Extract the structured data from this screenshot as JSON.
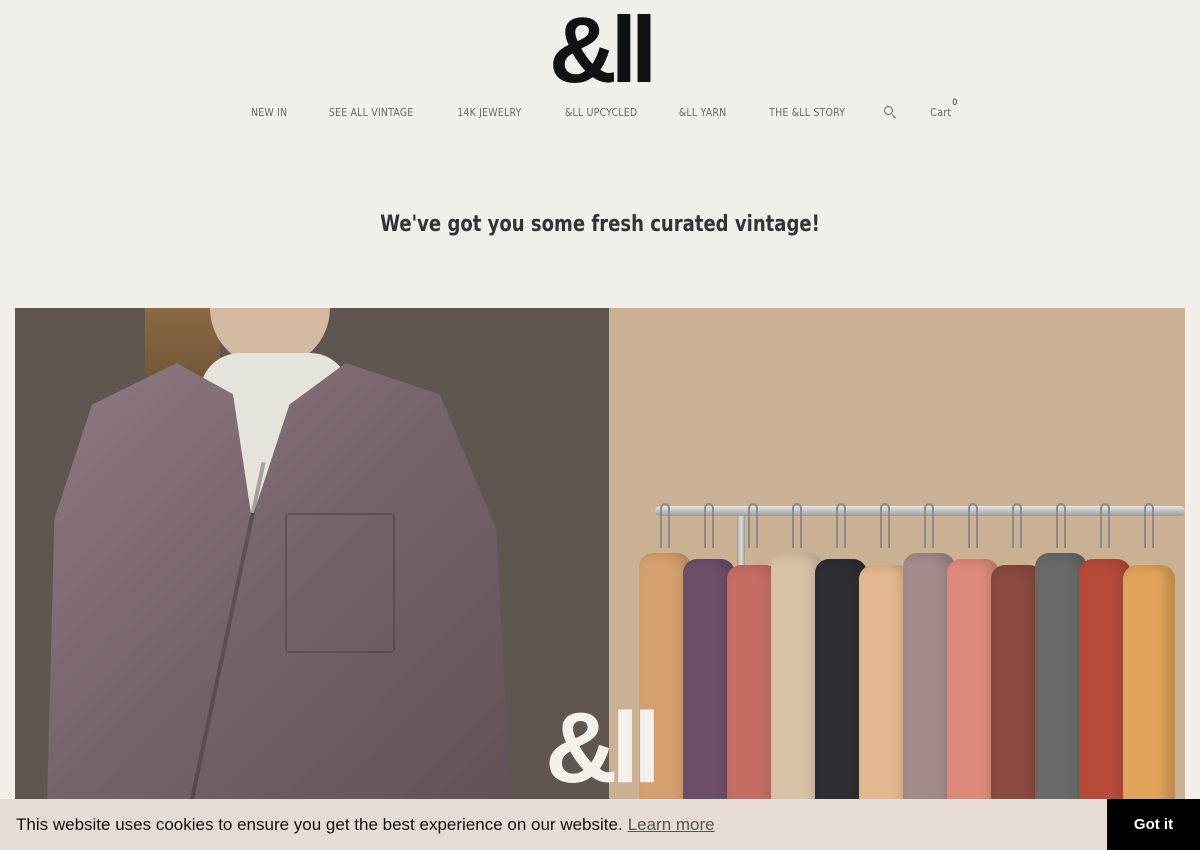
{
  "brand": {
    "logo": "&ll",
    "hero_logo": "&ll"
  },
  "nav": {
    "items": [
      {
        "label": "NEW IN"
      },
      {
        "label": "SEE ALL VINTAGE"
      },
      {
        "label": "14K JEWELRY"
      },
      {
        "label": "&ll UPCYCLED"
      },
      {
        "label": "&ll YARN"
      },
      {
        "label": "THE &ll STORY"
      }
    ],
    "search_icon": "search-icon",
    "cart_label": "Cart",
    "cart_count": "0"
  },
  "hero": {
    "headline": "We've got you some fresh curated vintage!",
    "colors": {
      "left_bg": "#5f5650",
      "shirt": "#8e7a80",
      "right_bg": "#cbb193",
      "garments": [
        "#d6a06e",
        "#6e4f6a",
        "#c46e63",
        "#d8c2a6",
        "#2e2d33",
        "#e3b88f",
        "#a38a8a",
        "#de8a7a",
        "#8a4a3e",
        "#6a6a6a",
        "#b84a3a",
        "#e0a45a"
      ]
    }
  },
  "cookie": {
    "message": "This website uses cookies to ensure you get the best experience on our website.",
    "link": "Learn more",
    "button": "Got it"
  }
}
